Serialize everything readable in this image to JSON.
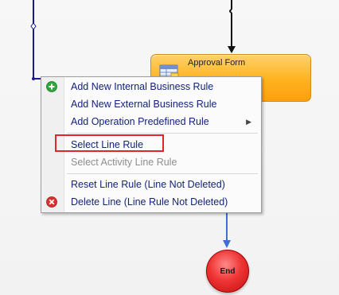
{
  "diagram": {
    "approval_node": {
      "title": "Approval Form",
      "icon": "form-table-icon"
    },
    "end_node": {
      "label": "End"
    }
  },
  "context_menu": {
    "items": [
      {
        "label": "Add New Internal Business Rule",
        "icon": "green-plus-icon",
        "disabled": false
      },
      {
        "label": "Add New External Business Rule",
        "disabled": false
      },
      {
        "label": "Add Operation Predefined Rule",
        "has_submenu": true,
        "disabled": false
      },
      {
        "label": "Select Line Rule",
        "disabled": false,
        "highlighted": true
      },
      {
        "label": "Select Activity Line Rule",
        "disabled": true
      },
      {
        "label": "Reset Line Rule (Line Not Deleted)",
        "disabled": false
      },
      {
        "label": "Delete Line (Line Rule Not Deleted)",
        "icon": "red-delete-icon",
        "disabled": false
      }
    ]
  },
  "colors": {
    "menu_text": "#13237a",
    "disabled_text": "#8e8e8e",
    "highlight": "#e0252b",
    "connector_dark": "#1a1a8c",
    "connector_blue": "#3b6fd6",
    "approval_fill": "#ffb21e",
    "end_fill": "#ef3535"
  }
}
